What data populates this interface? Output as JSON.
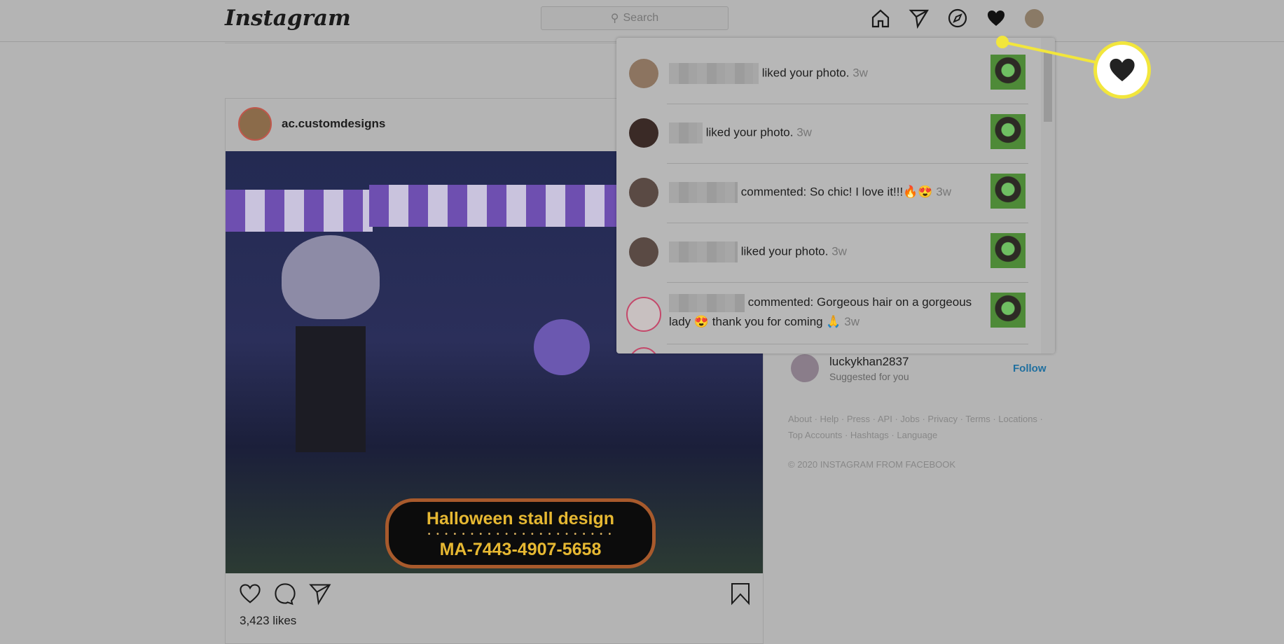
{
  "header": {
    "logo": "Instagram",
    "search_placeholder": "Search"
  },
  "post": {
    "username": "ac.customdesigns",
    "image_text_1": "Halloween stall design",
    "image_text_2": "MA-7443-4907-5658",
    "likes": "3,423 likes"
  },
  "notifications": [
    {
      "action": "liked your photo.",
      "time": "3w"
    },
    {
      "action": "liked your photo.",
      "time": "3w"
    },
    {
      "action": "commented: So chic! I love it!!!🔥😍",
      "time": "3w"
    },
    {
      "action": "liked your photo.",
      "time": "3w"
    },
    {
      "action": "commented: Gorgeous hair on a gorgeous lady 😍 thank you for coming 🙏",
      "time": "3w"
    }
  ],
  "suggestion": {
    "username": "luckykhan2837",
    "subtitle": "Suggested for you",
    "follow": "Follow"
  },
  "footer": {
    "links_1": "About · Help · Press · API · Jobs · Privacy · Terms · Locations ·",
    "links_2": "Top Accounts · Hashtags · Language",
    "copyright": "© 2020 INSTAGRAM FROM FACEBOOK"
  },
  "colors": {
    "highlight": "#f2e63c",
    "follow": "#1f6f9f"
  }
}
